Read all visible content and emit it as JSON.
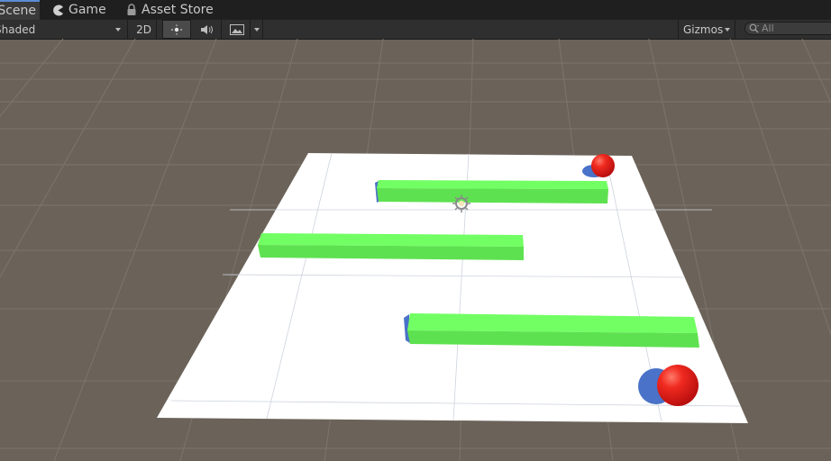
{
  "tabs": [
    {
      "label": "Scene",
      "icon": "scene-icon",
      "active": true
    },
    {
      "label": "Game",
      "icon": "pacman-icon",
      "active": false
    },
    {
      "label": "Asset Store",
      "icon": "lock-icon",
      "active": false
    }
  ],
  "toolbar": {
    "shading_mode": "Shaded",
    "mode_2d_label": "2D",
    "lighting_icon": "sun-icon",
    "audio_icon": "speaker-icon",
    "effects_icon": "image-icon",
    "gizmos_label": "Gizmos",
    "search_placeholder": "All",
    "search_icon": "search-icon"
  },
  "scene": {
    "colors": {
      "background": "#6b6359",
      "floor": "#ffffff",
      "wall_top": "#72ff64",
      "wall_front": "#5ee150",
      "wall_shadow": "#4a72c8",
      "sphere": "#e81818",
      "grid_line": "#7d756b"
    },
    "objects": [
      {
        "type": "plane",
        "name": "floor"
      },
      {
        "type": "wall",
        "name": "wall-top"
      },
      {
        "type": "wall",
        "name": "wall-middle"
      },
      {
        "type": "wall",
        "name": "wall-bottom"
      },
      {
        "type": "sphere",
        "name": "sphere-small"
      },
      {
        "type": "sphere",
        "name": "sphere-large"
      },
      {
        "type": "light-gizmo",
        "name": "directional-light-gizmo",
        "icon": "sun-gizmo-icon"
      }
    ]
  }
}
